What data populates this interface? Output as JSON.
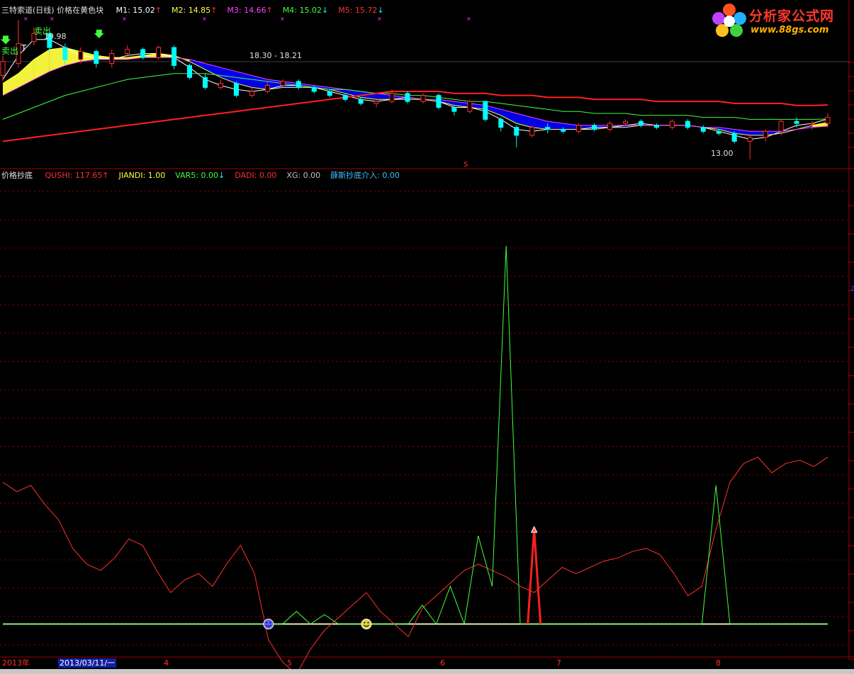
{
  "top_legend": {
    "title": "三特索道(日线)",
    "subtitle": "价格在黄色块",
    "items": [
      {
        "text": "M1: 15.02",
        "arrow": "↑",
        "color": "#ffffff",
        "arrow_color": "#ff3030"
      },
      {
        "text": "M2: 14.85",
        "arrow": "↑",
        "color": "#ffff40",
        "arrow_color": "#ff3030"
      },
      {
        "text": "M3: 14.66",
        "arrow": "↑",
        "color": "#ff40ff",
        "arrow_color": "#ff3030"
      },
      {
        "text": "M4: 15.02",
        "arrow": "↓",
        "color": "#40ff40",
        "arrow_color": "#00ffff"
      },
      {
        "text": "M5: 15.72",
        "arrow": "↓",
        "color": "#ff3030",
        "arrow_color": "#00ffff"
      }
    ]
  },
  "bottom_legend": {
    "title": "价格抄底",
    "items": [
      {
        "text": "QUSHI: 117.65",
        "arrow": "↑",
        "color": "#ff3030",
        "arrow_color": "#ff3030"
      },
      {
        "text": "JIANDI: 1.00",
        "arrow": "",
        "color": "#ffff40",
        "arrow_color": "#ffff40"
      },
      {
        "text": "VAR5: 0.00",
        "arrow": "↓",
        "color": "#40ff40",
        "arrow_color": "#00ffff"
      },
      {
        "text": "DADI: 0.00",
        "arrow": "",
        "color": "#ff3030",
        "arrow_color": "#ff3030"
      },
      {
        "text": "XG: 0.00",
        "arrow": "",
        "color": "#c0c0c0",
        "arrow_color": "#c0c0c0"
      },
      {
        "text": "薛斯抄底介入: 0.00",
        "arrow": "",
        "color": "#40c0ff",
        "arrow_color": "#40c0ff"
      }
    ]
  },
  "logo": {
    "name": "分析家公式网",
    "url": "www.88gs.com"
  },
  "annotations": {
    "sell1": "卖出",
    "sell2": "卖出",
    "t_mark": "T",
    "high_label": "19.98",
    "range_label": "18.30 - 18.21",
    "low_label": "13.00",
    "s_mark": "S"
  },
  "time_axis": {
    "year_label": "2013年",
    "cursor_date": "2013/03/11/一",
    "month_labels": [
      "4",
      "5",
      "6",
      "7",
      "8"
    ]
  },
  "colors": {
    "up": "#ff3030",
    "down": "#00ffff",
    "ma_white": "#ffffff",
    "ma_yellow": "#ffff40",
    "ma_magenta": "#ff40ff",
    "ma_green": "#40ff40",
    "ma_red": "#ff2020",
    "blue_band": "#0000ff",
    "grid": "#900000",
    "baseline": "#e8e8b0"
  },
  "chart_data": [
    {
      "type": "line",
      "panel": "price",
      "title": "三特索道(日线)",
      "price_range": [
        12.6,
        20.2
      ],
      "candles": {
        "x": [
          0,
          3,
          6,
          9,
          12,
          15,
          18,
          21,
          24,
          27,
          30,
          33,
          36,
          39,
          42,
          45,
          48,
          51,
          54,
          57,
          60,
          63,
          66,
          69,
          72,
          75,
          78,
          81,
          84,
          87,
          90,
          93,
          96,
          99,
          102,
          105,
          108,
          111,
          114,
          117,
          120,
          123,
          126,
          129,
          132,
          135,
          138,
          141,
          144,
          147,
          150,
          153,
          156,
          159
        ],
        "open": [
          17.2,
          17.8,
          18.9,
          19.3,
          18.6,
          18.0,
          18.4,
          17.8,
          18.3,
          18.5,
          18.1,
          18.6,
          17.7,
          17.1,
          16.6,
          16.8,
          16.2,
          16.4,
          16.7,
          16.9,
          16.6,
          16.4,
          16.2,
          16.0,
          15.8,
          15.9,
          16.3,
          15.9,
          16.2,
          15.6,
          15.4,
          15.9,
          15.0,
          14.6,
          14.2,
          14.6,
          14.5,
          14.4,
          14.7,
          14.5,
          14.8,
          14.9,
          14.7,
          14.6,
          14.9,
          14.6,
          14.4,
          14.3,
          13.9,
          14.1,
          14.4,
          14.9,
          14.8,
          14.8
        ],
        "close": [
          17.9,
          18.8,
          19.3,
          18.6,
          18.0,
          18.4,
          17.8,
          18.3,
          18.5,
          18.1,
          18.6,
          17.7,
          17.1,
          16.6,
          16.8,
          16.2,
          16.4,
          16.7,
          16.9,
          16.6,
          16.4,
          16.2,
          16.0,
          15.8,
          15.9,
          16.3,
          15.9,
          16.2,
          15.6,
          15.4,
          15.9,
          15.0,
          14.6,
          14.2,
          14.6,
          14.5,
          14.4,
          14.7,
          14.5,
          14.8,
          14.9,
          14.7,
          14.6,
          14.9,
          14.6,
          14.4,
          14.3,
          13.9,
          14.1,
          14.4,
          14.9,
          14.8,
          14.8,
          15.1
        ],
        "high": [
          18.2,
          19.98,
          19.6,
          19.4,
          18.8,
          18.6,
          18.5,
          18.5,
          18.7,
          18.6,
          18.7,
          18.7,
          17.8,
          17.3,
          17.0,
          16.9,
          16.6,
          16.9,
          17.0,
          17.0,
          16.7,
          16.5,
          16.3,
          16.1,
          16.0,
          16.5,
          16.4,
          16.3,
          16.3,
          15.7,
          16.0,
          15.9,
          15.1,
          14.7,
          14.7,
          14.8,
          14.6,
          14.8,
          14.8,
          14.9,
          15.0,
          15.0,
          14.8,
          15.0,
          15.0,
          14.7,
          14.5,
          14.4,
          14.2,
          14.5,
          15.0,
          15.1,
          14.9,
          15.3
        ],
        "low": [
          16.9,
          17.6,
          18.7,
          18.4,
          17.8,
          17.8,
          17.6,
          17.6,
          18.1,
          18.0,
          18.0,
          17.5,
          17.0,
          16.5,
          16.5,
          16.1,
          16.1,
          16.3,
          16.6,
          16.5,
          16.3,
          16.1,
          15.9,
          15.7,
          15.6,
          15.8,
          15.8,
          15.8,
          15.5,
          15.2,
          15.3,
          14.9,
          14.4,
          13.6,
          14.1,
          14.3,
          14.3,
          14.3,
          14.4,
          14.4,
          14.7,
          14.6,
          14.5,
          14.5,
          14.5,
          14.3,
          14.2,
          13.8,
          13.0,
          13.9,
          14.2,
          14.6,
          14.5,
          14.6
        ]
      },
      "series": [
        {
          "name": "M1",
          "color": "#ffffff",
          "values": [
            17.0,
            18.2,
            19.0,
            19.0,
            18.6,
            18.2,
            18.1,
            18.0,
            18.2,
            18.3,
            18.3,
            18.1,
            17.6,
            17.0,
            16.7,
            16.5,
            16.4,
            16.5,
            16.7,
            16.7,
            16.6,
            16.4,
            16.2,
            16.0,
            15.9,
            16.0,
            16.1,
            16.0,
            15.9,
            15.6,
            15.6,
            15.4,
            15.0,
            14.5,
            14.4,
            14.5,
            14.5,
            14.5,
            14.6,
            14.6,
            14.7,
            14.8,
            14.7,
            14.7,
            14.7,
            14.6,
            14.4,
            14.2,
            14.0,
            14.1,
            14.4,
            14.7,
            14.8,
            15.02
          ]
        },
        {
          "name": "M2",
          "color": "#ffff40",
          "values": [
            16.8,
            17.3,
            18.0,
            18.5,
            18.6,
            18.4,
            18.2,
            18.1,
            18.1,
            18.2,
            18.3,
            18.2,
            17.9,
            17.5,
            17.1,
            16.8,
            16.6,
            16.5,
            16.6,
            16.6,
            16.6,
            16.5,
            16.3,
            16.1,
            16.0,
            16.0,
            16.0,
            16.0,
            15.9,
            15.7,
            15.6,
            15.5,
            15.2,
            14.8,
            14.6,
            14.5,
            14.5,
            14.5,
            14.5,
            14.6,
            14.6,
            14.7,
            14.7,
            14.7,
            14.7,
            14.6,
            14.5,
            14.3,
            14.2,
            14.2,
            14.3,
            14.5,
            14.7,
            14.85
          ]
        },
        {
          "name": "M3",
          "color": "#ff40ff",
          "values": [
            16.2,
            16.6,
            17.0,
            17.4,
            17.7,
            17.9,
            18.0,
            18.0,
            18.0,
            18.1,
            18.1,
            18.1,
            18.0,
            17.8,
            17.6,
            17.4,
            17.2,
            17.0,
            16.9,
            16.8,
            16.7,
            16.6,
            16.5,
            16.4,
            16.3,
            16.2,
            16.1,
            16.0,
            16.0,
            15.9,
            15.8,
            15.7,
            15.5,
            15.3,
            15.1,
            14.9,
            14.8,
            14.7,
            14.7,
            14.7,
            14.7,
            14.7,
            14.7,
            14.7,
            14.7,
            14.6,
            14.6,
            14.5,
            14.4,
            14.4,
            14.4,
            14.5,
            14.6,
            14.66
          ]
        },
        {
          "name": "M4",
          "color": "#40ff40",
          "values": [
            15.0,
            15.3,
            15.6,
            15.9,
            16.2,
            16.4,
            16.6,
            16.8,
            17.0,
            17.1,
            17.2,
            17.3,
            17.3,
            17.3,
            17.2,
            17.1,
            17.0,
            16.9,
            16.8,
            16.7,
            16.6,
            16.5,
            16.5,
            16.4,
            16.3,
            16.3,
            16.2,
            16.2,
            16.1,
            16.0,
            15.9,
            15.9,
            15.8,
            15.7,
            15.6,
            15.5,
            15.4,
            15.4,
            15.3,
            15.3,
            15.3,
            15.2,
            15.2,
            15.2,
            15.2,
            15.1,
            15.1,
            15.1,
            15.0,
            15.0,
            15.0,
            15.0,
            15.0,
            15.02
          ]
        },
        {
          "name": "M5",
          "color": "#ff2020",
          "values": [
            13.9,
            14.0,
            14.1,
            14.2,
            14.3,
            14.4,
            14.5,
            14.6,
            14.7,
            14.8,
            14.9,
            15.0,
            15.1,
            15.2,
            15.3,
            15.4,
            15.5,
            15.6,
            15.7,
            15.8,
            15.9,
            16.0,
            16.1,
            16.2,
            16.3,
            16.4,
            16.4,
            16.4,
            16.4,
            16.3,
            16.3,
            16.3,
            16.2,
            16.2,
            16.2,
            16.1,
            16.1,
            16.1,
            16.0,
            16.0,
            16.0,
            16.0,
            15.9,
            15.9,
            15.9,
            15.9,
            15.9,
            15.8,
            15.8,
            15.8,
            15.8,
            15.7,
            15.7,
            15.72
          ]
        }
      ],
      "markers": [
        {
          "kind": "sell",
          "x": 0,
          "text": "卖出"
        },
        {
          "kind": "sell",
          "x": 6,
          "text": "卖出"
        },
        {
          "kind": "high",
          "x": 3,
          "value": 19.98
        },
        {
          "kind": "range",
          "x": 42,
          "text": "18.30 - 18.21"
        },
        {
          "kind": "low",
          "x": 147,
          "value": 13.0
        }
      ]
    },
    {
      "type": "line",
      "panel": "indicator",
      "title": "价格抄底",
      "value_range": [
        -10,
        140
      ],
      "series": [
        {
          "name": "QUSHI",
          "color": "#ff3030",
          "values": [
            45,
            42,
            44,
            38,
            33,
            24,
            19,
            17,
            21,
            27,
            25,
            17,
            10,
            14,
            16,
            12,
            19,
            25,
            16,
            -5,
            -12,
            -16,
            -8,
            -2,
            2,
            6,
            10,
            4,
            0,
            -4,
            5,
            9,
            13,
            17,
            19,
            17,
            15,
            12,
            10,
            14,
            18,
            16,
            18,
            20,
            21,
            23,
            24,
            22,
            16,
            9,
            12,
            30,
            45,
            51,
            53,
            48,
            51,
            52,
            50,
            53
          ]
        },
        {
          "name": "VAR5",
          "color": "#40ff40",
          "values": [
            0,
            0,
            0,
            0,
            0,
            0,
            0,
            0,
            0,
            0,
            0,
            0,
            0,
            0,
            0,
            0,
            0,
            0,
            0,
            0,
            0,
            4,
            0,
            3,
            0,
            0,
            0,
            0,
            0,
            0,
            6,
            0,
            12,
            0,
            28,
            12,
            120,
            0,
            0,
            0,
            0,
            0,
            0,
            0,
            0,
            0,
            0,
            0,
            0,
            0,
            0,
            44,
            0,
            0,
            0,
            0,
            0,
            0,
            0,
            0
          ]
        },
        {
          "name": "JIANDI",
          "color": "#e8e8b0",
          "values": [
            0,
            0,
            0,
            0,
            0,
            0,
            0,
            0,
            0,
            0,
            0,
            0,
            0,
            0,
            0,
            0,
            0,
            0,
            0,
            0,
            0,
            0,
            0,
            0,
            0,
            0,
            0,
            0,
            0,
            0,
            0,
            0,
            0,
            0,
            0,
            0,
            0,
            0,
            0,
            0,
            0,
            0,
            0,
            0,
            0,
            0,
            0,
            0,
            0,
            0,
            0,
            0,
            0,
            0,
            0,
            0,
            0,
            0,
            0,
            0
          ]
        },
        {
          "name": "DADI",
          "color": "#ff2020",
          "values": [
            0,
            0,
            0,
            0,
            0,
            0,
            0,
            0,
            0,
            0,
            0,
            0,
            0,
            0,
            0,
            0,
            0,
            0,
            0,
            0,
            0,
            0,
            0,
            0,
            0,
            0,
            0,
            0,
            0,
            0,
            0,
            0,
            0,
            0,
            0,
            0,
            0,
            0,
            30,
            0,
            0,
            0,
            0,
            0,
            0,
            0,
            0,
            0,
            0,
            0,
            0,
            0,
            0,
            0,
            0,
            0,
            0,
            0,
            0,
            0
          ]
        }
      ],
      "signals": [
        {
          "kind": "face",
          "x": 19,
          "color": "#6060ff"
        },
        {
          "kind": "face",
          "x": 26,
          "color": "#e0d040"
        }
      ]
    }
  ]
}
